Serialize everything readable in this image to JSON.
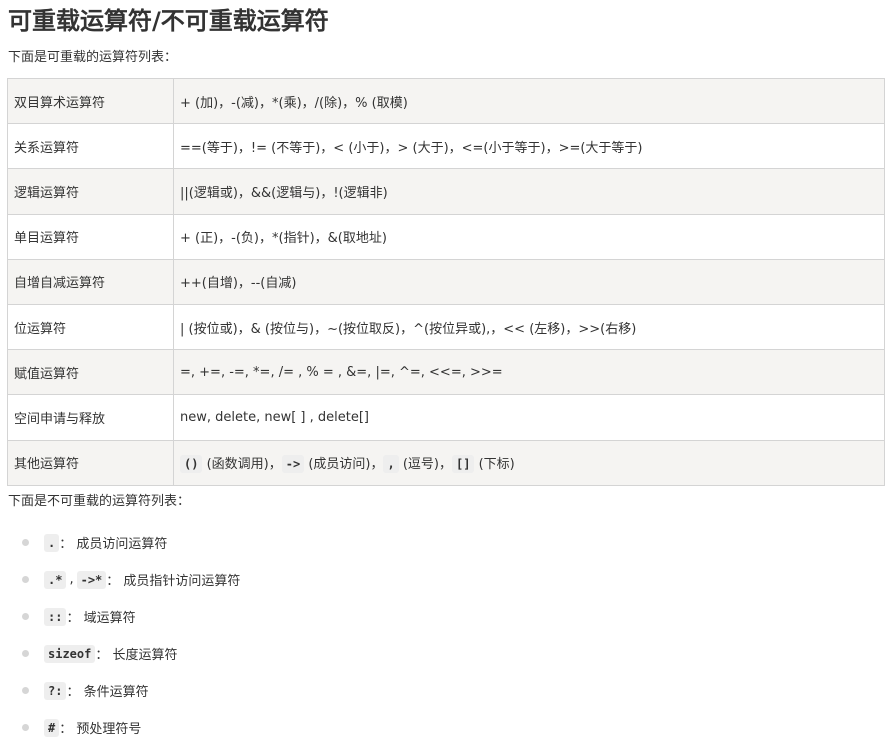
{
  "title": "可重载运算符/不可重载运算符",
  "intro_overloadable": "下面是可重载的运算符列表：",
  "overloadable_rows": [
    {
      "category": "双目算术运算符",
      "operators": "+ (加)，-(减)，*(乘)，/(除)，% (取模)"
    },
    {
      "category": "关系运算符",
      "operators": "==(等于)，!= (不等于)，< (小于)，> (大于)，<=(小于等于)，>=(大于等于)"
    },
    {
      "category": "逻辑运算符",
      "operators": "||(逻辑或)，&&(逻辑与)，!(逻辑非)"
    },
    {
      "category": "单目运算符",
      "operators": "+ (正)，-(负)，*(指针)，&(取地址)"
    },
    {
      "category": "自增自减运算符",
      "operators": "++(自增)，--(自减)"
    },
    {
      "category": "位运算符",
      "operators": "| (按位或)，& (按位与)，~(按位取反)，^(按位异或),，<< (左移)，>>(右移)"
    },
    {
      "category": "赋值运算符",
      "operators": "=, +=, -=, *=, /= , % = , &=, |=, ^=, <<=, >>="
    },
    {
      "category": "空间申请与释放",
      "operators": "new, delete, new[ ] , delete[]"
    },
    {
      "category": "其他运算符",
      "parts": [
        {
          "code": "()",
          "text": " (函数调用)，"
        },
        {
          "code": "->",
          "text": " (成员访问)，"
        },
        {
          "code": ",",
          "text": " (逗号)，"
        },
        {
          "code": "[]",
          "text": " (下标)"
        }
      ]
    }
  ],
  "intro_non_overloadable": "下面是不可重载的运算符列表：",
  "non_overloadable": [
    {
      "codes": [
        "."
      ],
      "desc": "： 成员访问运算符"
    },
    {
      "codes": [
        ".*",
        "->*"
      ],
      "separator": ",",
      "desc": "： 成员指针访问运算符"
    },
    {
      "codes": [
        "::"
      ],
      "desc": "： 域运算符"
    },
    {
      "codes": [
        "sizeof"
      ],
      "desc": "： 长度运算符"
    },
    {
      "codes": [
        "?:"
      ],
      "desc": "： 条件运算符"
    },
    {
      "codes": [
        "#"
      ],
      "desc": "： 预处理符号"
    }
  ]
}
